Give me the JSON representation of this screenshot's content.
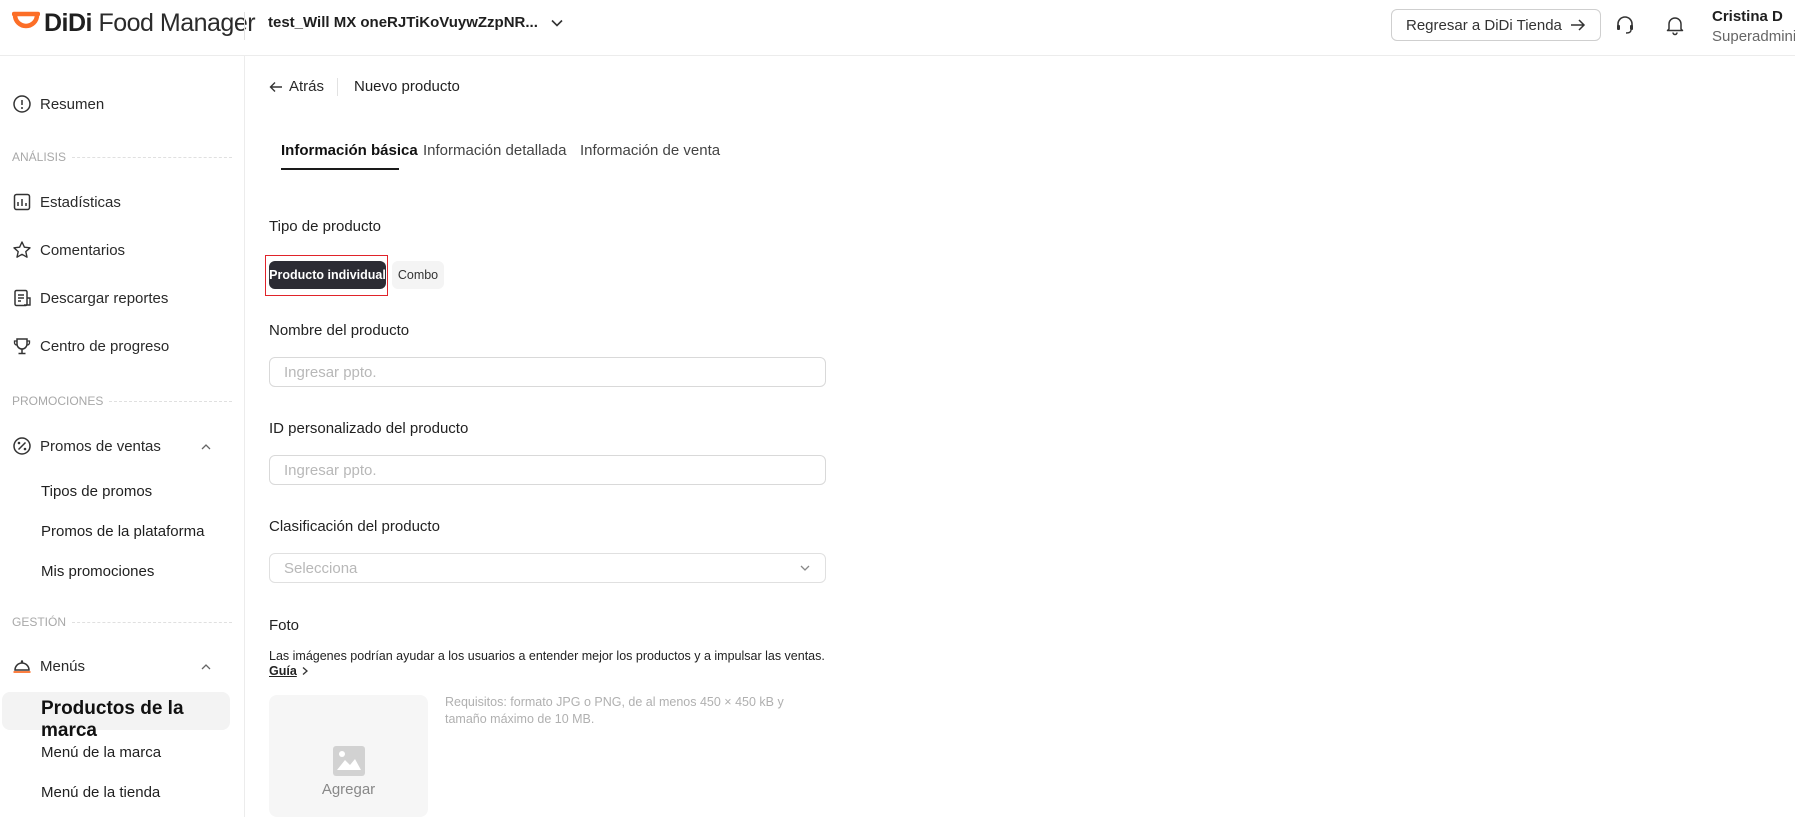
{
  "header": {
    "logo_didi": "DiDi",
    "logo_rest": " Food Manager",
    "store_name": "test_Will MX oneRJTiKoVuywZzpNR...",
    "back_to_store": "Regresar a DiDi Tienda",
    "user_name": "Cristina D",
    "user_role": "Superadmini",
    "brand_color": "#fc6e27"
  },
  "sidebar": {
    "summary": "Resumen",
    "analysis_section": "ANÁLISIS",
    "stats": "Estadísticas",
    "comments": "Comentarios",
    "reports": "Descargar reportes",
    "progress": "Centro de progreso",
    "promos_section": "PROMOCIONES",
    "sales_promos": "Promos de ventas",
    "promo_types": "Tipos de promos",
    "platform_promos": "Promos de la plataforma",
    "my_promos": "Mis promociones",
    "management_section": "GESTIÓN",
    "menus": "Menús",
    "brand_products": "Productos de la marca",
    "brand_menu": "Menú de la marca",
    "store_menu": "Menú de la tienda"
  },
  "main": {
    "back": "Atrás",
    "page_title": "Nuevo producto",
    "tabs": [
      {
        "label": "Información básica",
        "active": true
      },
      {
        "label": "Información detallada",
        "active": false
      },
      {
        "label": "Información de venta",
        "active": false
      }
    ],
    "product_type_label": "Tipo de producto",
    "type_individual": "Producto individual",
    "type_combo": "Combo",
    "name_label": "Nombre del producto",
    "name_placeholder": "Ingresar ppto.",
    "custom_id_label": "ID personalizado del producto",
    "custom_id_placeholder": "Ingresar ppto.",
    "classification_label": "Clasificación del producto",
    "classification_placeholder": "Selecciona",
    "photo_label": "Foto",
    "photo_description": "Las imágenes podrían ayudar a los usuarios a entender mejor los productos y a impulsar las ventas.",
    "guide": "Guía",
    "upload_label": "Agregar",
    "requirements": "Requisitos: formato JPG o PNG, de al menos 450 × 450 kB y tamaño máximo de 10 MB."
  }
}
